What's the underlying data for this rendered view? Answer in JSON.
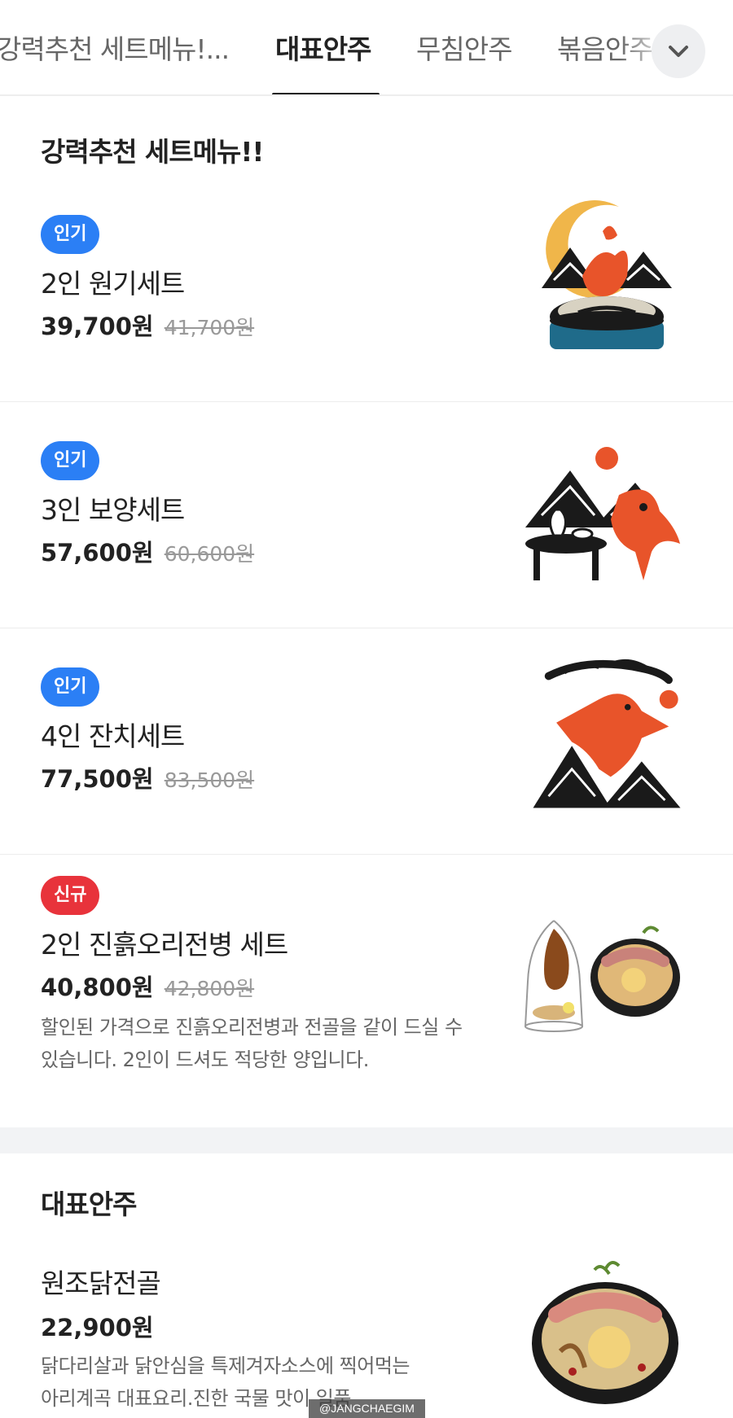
{
  "tabs": [
    {
      "label": "강력추천 세트메뉴!...",
      "active": false
    },
    {
      "label": "대표안주",
      "active": true
    },
    {
      "label": "무침안주",
      "active": false
    },
    {
      "label": "볶음안주",
      "active": false
    }
  ],
  "sections": [
    {
      "title": "강력추천 세트메뉴!!",
      "items": [
        {
          "badge": "인기",
          "badge_color": "#2b7ff5",
          "name": "2인 원기세트",
          "price": "39,700원",
          "original_price": "41,700원"
        },
        {
          "badge": "인기",
          "badge_color": "#2b7ff5",
          "name": "3인 보양세트",
          "price": "57,600원",
          "original_price": "60,600원"
        },
        {
          "badge": "인기",
          "badge_color": "#2b7ff5",
          "name": "4인 잔치세트",
          "price": "77,500원",
          "original_price": "83,500원"
        },
        {
          "badge": "신규",
          "badge_color": "#e8333b",
          "name": "2인 진흙오리전병 세트",
          "price": "40,800원",
          "original_price": "42,800원",
          "description": [
            "할인된 가격으로 진흙오리전병과 전골을 같이 드실 수",
            "있습니다. 2인이 드셔도 적당한 양입니다."
          ]
        }
      ]
    },
    {
      "title": "대표안주",
      "items": [
        {
          "name": "원조닭전골",
          "price": "22,900원",
          "description": [
            "닭다리살과 닭안심을 특제겨자소스에 찍어먹는",
            "아리계곡 대표요리.진한 국물 맛이 일품"
          ]
        }
      ]
    }
  ],
  "watermark": "@JANGCHAEGIM",
  "colors": {
    "accent_orange": "#e8542a",
    "badge_blue": "#2b7ff5",
    "badge_red": "#e8333b"
  }
}
